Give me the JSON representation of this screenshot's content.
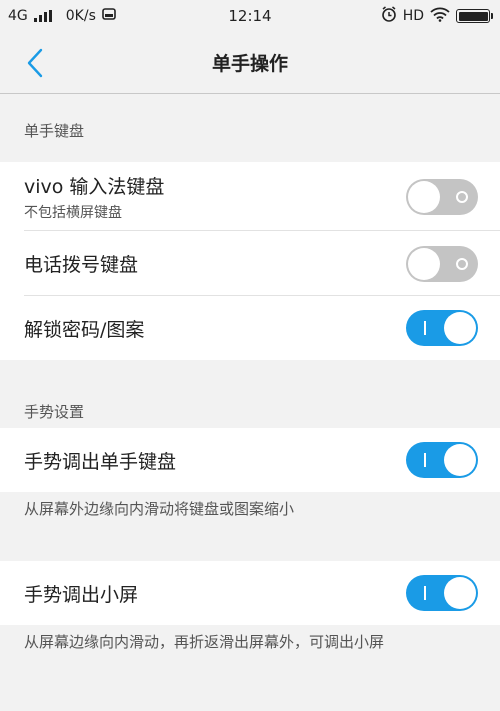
{
  "status_bar": {
    "network": "4G",
    "speed": "0K/s",
    "time": "12:14",
    "hd": "HD"
  },
  "header": {
    "title": "单手操作"
  },
  "sections": {
    "keyboard": {
      "header": "单手键盘",
      "vivo_ime": {
        "label": "vivo 输入法键盘",
        "subtitle": "不包括横屏键盘",
        "on": false
      },
      "dialer": {
        "label": "电话拨号键盘",
        "on": false
      },
      "unlock": {
        "label": "解锁密码/图案",
        "on": true
      }
    },
    "gesture": {
      "header": "手势设置",
      "gesture_keyboard": {
        "label": "手势调出单手键盘",
        "on": true,
        "note": "从屏幕外边缘向内滑动将键盘或图案缩小"
      },
      "gesture_small_screen": {
        "label": "手势调出小屏",
        "on": true,
        "note": "从屏幕边缘向内滑动，再折返滑出屏幕外，可调出小屏"
      }
    }
  },
  "colors": {
    "accent": "#1a9be6",
    "toggle_off": "#c4c4c4",
    "background": "#f2f2f2"
  }
}
